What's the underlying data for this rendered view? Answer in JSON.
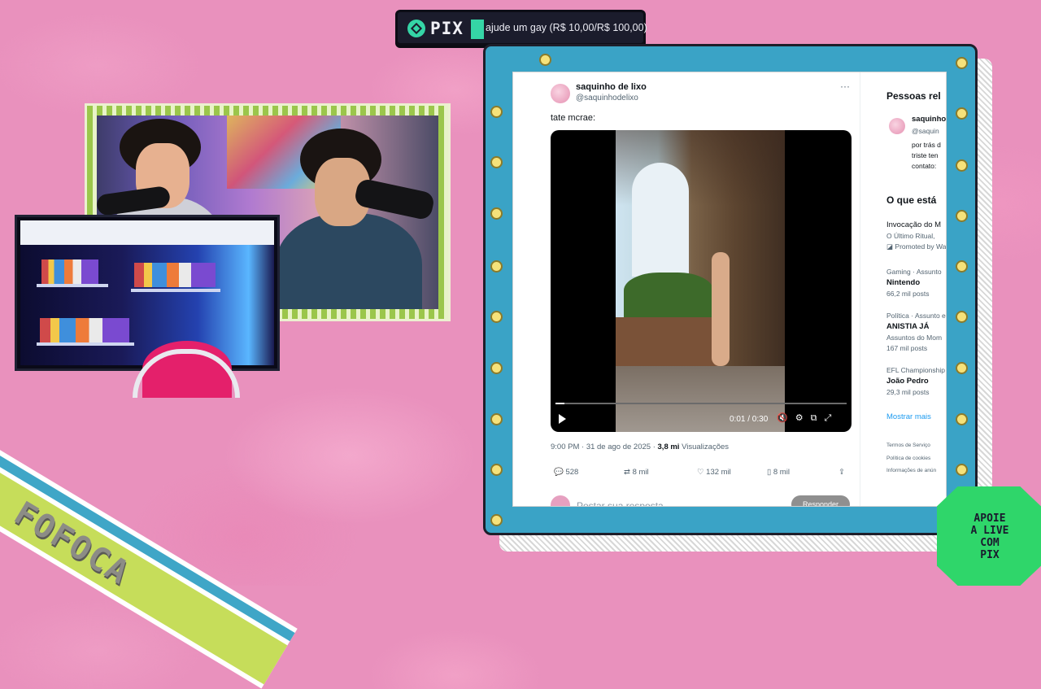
{
  "overlay": {
    "pix_label": "PIX",
    "pix_message": "ajude um gay (R$ 10,00/R$ 100,00)",
    "ribbon_text": "FOFOCA",
    "badge_text": "APOIE\nA LIVE\nCOM\nPIX"
  },
  "tweet": {
    "username": "saquinho de lixo",
    "handle": "@saquinhodelixo",
    "more": "···",
    "text": "tate mcrae:",
    "video": {
      "time": "0:01 / 0:30",
      "progress": 0.03
    },
    "timestamp": "9:00 PM · 31 de ago de 2025 · ",
    "views_count": "3,8 mi",
    "views_label": " Visualizações",
    "actions": {
      "replies": "528",
      "reposts": "8 mil",
      "likes": "132 mil",
      "bookmarks": "8 mil"
    },
    "reply_placeholder": "Postar sua resposta",
    "reply_button": "Responder"
  },
  "sidebar": {
    "related_heading": "Pessoas rel",
    "related_name": "saquinho",
    "related_handle": "@saquin",
    "related_bio": [
      "por trás d",
      "triste ten",
      "contato: "
    ],
    "trending_heading": "O que está",
    "trends": [
      {
        "context": "",
        "title": "Invocação do M",
        "subtitle": "O Último Ritual,",
        "meta": "Promoted by Wa"
      },
      {
        "context": "Gaming · Assunto",
        "title": "Nintendo",
        "subtitle": "",
        "meta": "66,2 mil posts"
      },
      {
        "context": "Política · Assunto e",
        "title": "ANISTIA JÁ",
        "subtitle": "Assuntos do Mom",
        "meta": "167 mil posts"
      },
      {
        "context": "EFL Championship",
        "title": "João Pedro",
        "subtitle": "",
        "meta": "29,3 mil posts"
      }
    ],
    "show_more": "Mostrar mais",
    "footer": [
      "Termos de Serviço",
      "Política de cookies",
      "Informações de anún"
    ]
  }
}
